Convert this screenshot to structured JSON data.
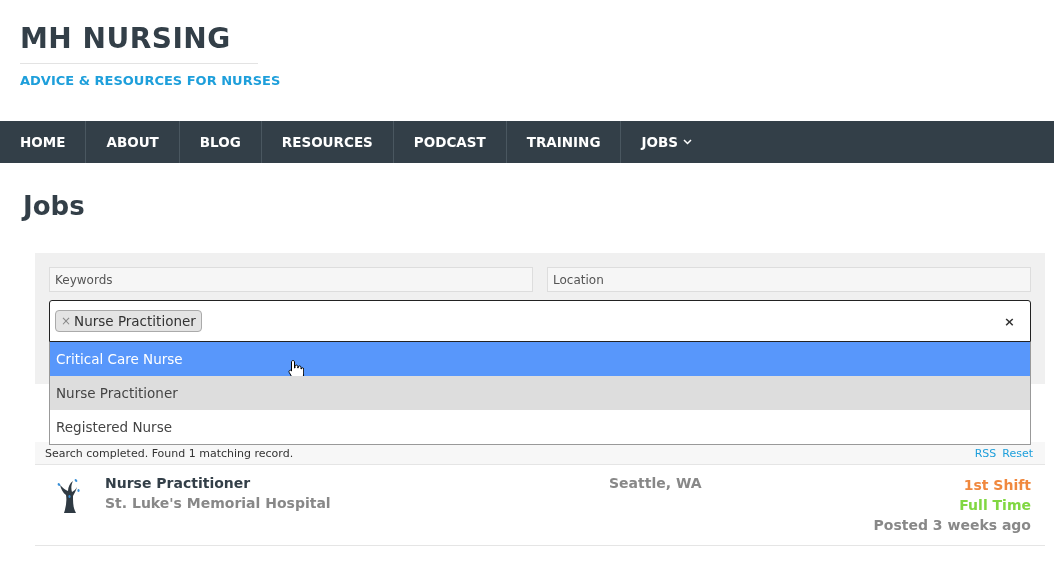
{
  "site": {
    "title": "MH NURSING",
    "tagline": "ADVICE & RESOURCES FOR NURSES"
  },
  "nav": [
    {
      "label": "HOME",
      "has_caret": false
    },
    {
      "label": "ABOUT",
      "has_caret": false
    },
    {
      "label": "BLOG",
      "has_caret": false
    },
    {
      "label": "RESOURCES",
      "has_caret": false
    },
    {
      "label": "PODCAST",
      "has_caret": false
    },
    {
      "label": "TRAINING",
      "has_caret": false
    },
    {
      "label": "JOBS",
      "has_caret": true
    }
  ],
  "page_title": "Jobs",
  "filters": {
    "keywords": {
      "placeholder": "Keywords"
    },
    "location": {
      "placeholder": "Location"
    },
    "job_type": {
      "tags": [
        {
          "remove": "×",
          "label": "Nurse Practitioner"
        }
      ],
      "clear": "×",
      "options": [
        {
          "label": "Critical Care Nurse",
          "highlighted": true,
          "selected": false
        },
        {
          "label": "Nurse Practitioner",
          "highlighted": false,
          "selected": true
        },
        {
          "label": "Registered Nurse",
          "highlighted": false,
          "selected": false
        }
      ]
    }
  },
  "status": {
    "text": "Search completed. Found 1 matching record.",
    "links": [
      "RSS",
      "Reset"
    ]
  },
  "jobs": [
    {
      "title": "Nurse Practitioner",
      "company": "St. Luke's Memorial Hospital",
      "location": "Seattle, WA",
      "tags": [
        {
          "label": "1st Shift",
          "color": "#f0883e"
        },
        {
          "label": "Full Time",
          "color": "#81d742"
        }
      ],
      "posted": "Posted 3 weeks ago"
    }
  ]
}
